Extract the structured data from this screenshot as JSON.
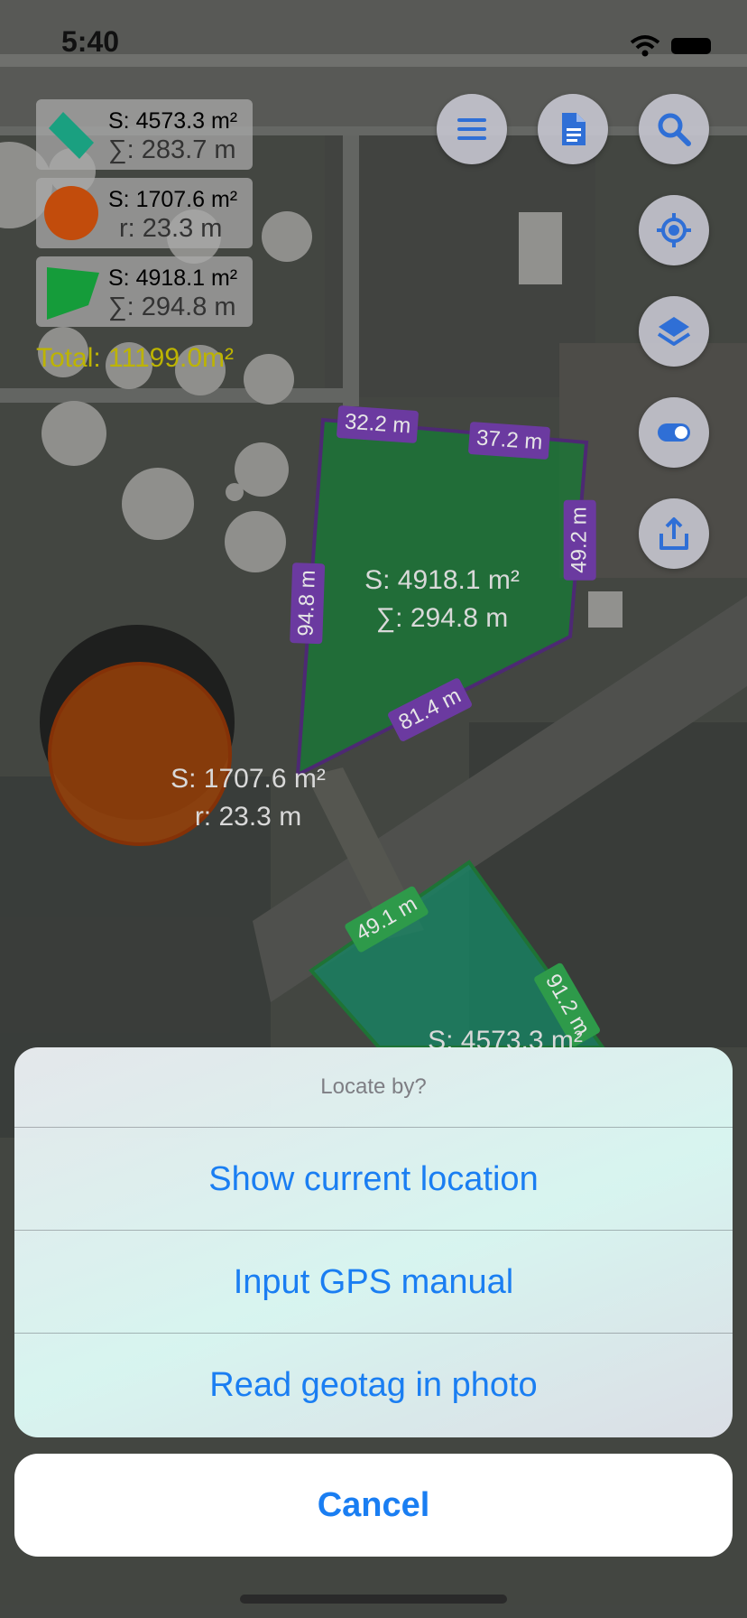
{
  "status_bar": {
    "time": "5:40"
  },
  "legend": [
    {
      "icon": "green-polygon-shape-icon",
      "area": "S: 4573.3 m²",
      "perimeter": "∑: 283.7 m",
      "color": "#1aa080"
    },
    {
      "icon": "orange-circle-shape-icon",
      "area": "S: 1707.6 m²",
      "perimeter": "r: 23.3 m",
      "color": "#c24c0c"
    },
    {
      "icon": "green-quad-shape-icon",
      "area": "S: 4918.1 m²",
      "perimeter": "∑: 294.8 m",
      "color": "#159c3a"
    }
  ],
  "total": "Total: 11199.0m²",
  "toolbar": {
    "menu_icon": "menu-icon",
    "document_icon": "document-icon",
    "search_icon": "search-icon",
    "locate_icon": "locate-target-icon",
    "layers_icon": "layers-icon",
    "toggle_icon": "toggle-icon",
    "share_icon": "share-icon"
  },
  "map": {
    "polygon_purple": {
      "area": "S: 4918.1 m²",
      "perimeter": "∑: 294.8 m",
      "edges": [
        "32.2 m",
        "37.2 m",
        "49.2 m",
        "81.4 m",
        "94.8 m"
      ],
      "color": "#1faa4a"
    },
    "circle": {
      "area": "S: 1707.6 m²",
      "radius": "r: 23.3 m",
      "color": "#d45a0c"
    },
    "polygon_green": {
      "area": "S: 4573.3 m²",
      "edges": [
        "49.1 m",
        "91.2 m"
      ],
      "color": "#1fb88a"
    }
  },
  "action_sheet": {
    "title": "Locate by?",
    "options": [
      "Show current location",
      "Input GPS manual",
      "Read geotag in photo"
    ],
    "cancel": "Cancel"
  },
  "colors": {
    "accent": "#1a7ef2",
    "total": "#bdb400"
  }
}
